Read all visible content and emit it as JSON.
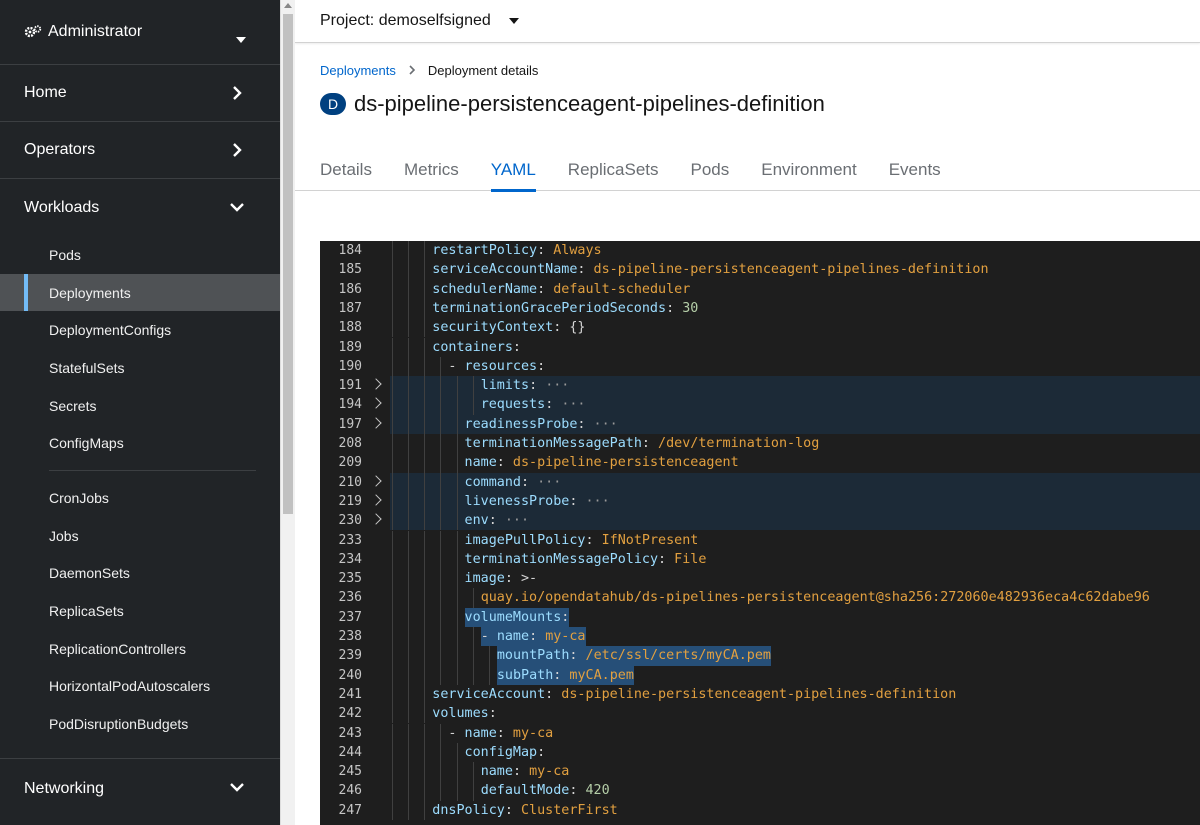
{
  "sidebar": {
    "perspective": "Administrator",
    "sections": [
      {
        "label": "Home"
      },
      {
        "label": "Operators"
      },
      {
        "label": "Workloads"
      }
    ],
    "workloads_items": [
      "Pods",
      "Deployments",
      "DeploymentConfigs",
      "StatefulSets",
      "Secrets",
      "ConfigMaps"
    ],
    "workloads_items_2": [
      "CronJobs",
      "Jobs",
      "DaemonSets",
      "ReplicaSets",
      "ReplicationControllers",
      "HorizontalPodAutoscalers",
      "PodDisruptionBudgets"
    ],
    "networking": "Networking"
  },
  "header": {
    "project": "Project: demoselfsigned"
  },
  "breadcrumb": {
    "parent": "Deployments",
    "separator": ">",
    "current": "Deployment details"
  },
  "title": {
    "badge": "D",
    "name": "ds-pipeline-persistenceagent-pipelines-definition"
  },
  "tabs": [
    "Details",
    "Metrics",
    "YAML",
    "ReplicaSets",
    "Pods",
    "Environment",
    "Events"
  ],
  "active_tab": "YAML",
  "editor": {
    "lines": [
      {
        "n": "184",
        "indent": 3,
        "key": "restartPolicy",
        "sep": ": ",
        "val": "Always",
        "vt": "strv"
      },
      {
        "n": "185",
        "indent": 3,
        "key": "serviceAccountName",
        "sep": ": ",
        "val": "ds-pipeline-persistenceagent-pipelines-definition",
        "vt": "strv"
      },
      {
        "n": "186",
        "indent": 3,
        "key": "schedulerName",
        "sep": ": ",
        "val": "default-scheduler",
        "vt": "strv"
      },
      {
        "n": "187",
        "indent": 3,
        "key": "terminationGracePeriodSeconds",
        "sep": ": ",
        "val": "30",
        "vt": "num"
      },
      {
        "n": "188",
        "indent": 3,
        "key": "securityContext",
        "sep": ": ",
        "val": "{}",
        "vt": "punct"
      },
      {
        "n": "189",
        "indent": 3,
        "key": "containers",
        "sep": ":",
        "val": "",
        "vt": "punct"
      },
      {
        "n": "190",
        "indent": 4,
        "dash": "- ",
        "key": "resources",
        "sep": ":",
        "val": "",
        "vt": "punct"
      },
      {
        "n": "191",
        "indent": 6,
        "key": "limits",
        "sep": ": ",
        "val": "···",
        "vt": "dots",
        "fold": true
      },
      {
        "n": "194",
        "indent": 6,
        "key": "requests",
        "sep": ": ",
        "val": "···",
        "vt": "dots",
        "fold": true
      },
      {
        "n": "197",
        "indent": 5,
        "key": "readinessProbe",
        "sep": ": ",
        "val": "···",
        "vt": "dots",
        "fold": true
      },
      {
        "n": "208",
        "indent": 5,
        "key": "terminationMessagePath",
        "sep": ": ",
        "val": "/dev/termination-log",
        "vt": "strv"
      },
      {
        "n": "209",
        "indent": 5,
        "key": "name",
        "sep": ": ",
        "val": "ds-pipeline-persistenceagent",
        "vt": "strv"
      },
      {
        "n": "210",
        "indent": 5,
        "key": "command",
        "sep": ": ",
        "val": "···",
        "vt": "dots",
        "fold": true
      },
      {
        "n": "219",
        "indent": 5,
        "key": "livenessProbe",
        "sep": ": ",
        "val": "···",
        "vt": "dots",
        "fold": true
      },
      {
        "n": "230",
        "indent": 5,
        "key": "env",
        "sep": ": ",
        "val": "···",
        "vt": "dots",
        "fold": true
      },
      {
        "n": "233",
        "indent": 5,
        "key": "imagePullPolicy",
        "sep": ": ",
        "val": "IfNotPresent",
        "vt": "strv"
      },
      {
        "n": "234",
        "indent": 5,
        "key": "terminationMessagePolicy",
        "sep": ": ",
        "val": "File",
        "vt": "strv"
      },
      {
        "n": "235",
        "indent": 5,
        "key": "image",
        "sep": ": ",
        "val": ">-",
        "vt": "punct"
      },
      {
        "n": "236",
        "indent": 6,
        "key": "",
        "sep": "",
        "val": "quay.io/opendatahub/ds-pipelines-persistenceagent@sha256:272060e482936eca4c62dabe96",
        "vt": "strv"
      },
      {
        "n": "237",
        "indent": 5,
        "key": "volumeMounts",
        "sep": ":",
        "val": "",
        "vt": "punct",
        "sel": true
      },
      {
        "n": "238",
        "indent": 6,
        "dash": "- ",
        "key": "name",
        "sep": ": ",
        "val": "my-ca",
        "vt": "strv",
        "sel": true
      },
      {
        "n": "239",
        "indent": 7,
        "key": "mountPath",
        "sep": ": ",
        "val": "/etc/ssl/certs/myCA.pem",
        "vt": "strv",
        "sel": true
      },
      {
        "n": "240",
        "indent": 7,
        "key": "subPath",
        "sep": ": ",
        "val": "myCA.pem",
        "vt": "strv",
        "sel": true
      },
      {
        "n": "241",
        "indent": 3,
        "key": "serviceAccount",
        "sep": ": ",
        "val": "ds-pipeline-persistenceagent-pipelines-definition",
        "vt": "strv"
      },
      {
        "n": "242",
        "indent": 3,
        "key": "volumes",
        "sep": ":",
        "val": "",
        "vt": "punct"
      },
      {
        "n": "243",
        "indent": 4,
        "dash": "- ",
        "key": "name",
        "sep": ": ",
        "val": "my-ca",
        "vt": "strv"
      },
      {
        "n": "244",
        "indent": 5,
        "key": "configMap",
        "sep": ":",
        "val": "",
        "vt": "punct"
      },
      {
        "n": "245",
        "indent": 6,
        "key": "name",
        "sep": ": ",
        "val": "my-ca",
        "vt": "strv"
      },
      {
        "n": "246",
        "indent": 6,
        "key": "defaultMode",
        "sep": ": ",
        "val": "420",
        "vt": "num"
      },
      {
        "n": "247",
        "indent": 3,
        "key": "dnsPolicy",
        "sep": ": ",
        "val": "ClusterFirst",
        "vt": "strv"
      }
    ]
  }
}
